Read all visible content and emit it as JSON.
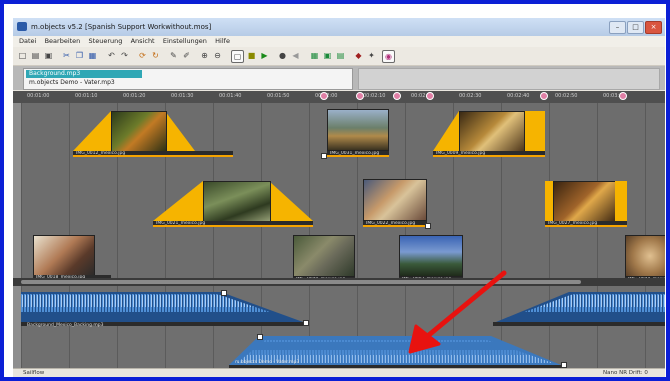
{
  "window": {
    "title": "m.objects v5.2  [Spanish Support Workwithout.mos]",
    "controls": [
      "–",
      "□",
      "×"
    ]
  },
  "menu": [
    "Datei",
    "Bearbeiten",
    "Steuerung",
    "Ansicht",
    "Einstellungen",
    "Hilfe"
  ],
  "toolbar": {
    "icons": [
      "new-icon",
      "open-icon",
      "save-icon",
      "cut-icon",
      "copy-icon",
      "paste-icon",
      "undo-icon",
      "redo-icon",
      "rotate-icon",
      "refresh-icon",
      "pen-icon",
      "pencil-icon",
      "zoom-in-icon",
      "zoom-out-icon",
      "select-frame-icon",
      "stop-icon",
      "play-icon",
      "record-icon",
      "prev-icon",
      "grid-icon",
      "image-icon",
      "clip-icon",
      "speaker-icon",
      "magic-icon",
      "circle-icon"
    ]
  },
  "objects": {
    "items": [
      "Background.mp3",
      "m.objects Demo - Vater.mp3"
    ]
  },
  "ruler": {
    "ticks": [
      "00:01:00",
      "00:01:10",
      "00:01:20",
      "00:01:30",
      "00:01:40",
      "00:01:50",
      "00:02:00",
      "00:02:10",
      "00:02:20",
      "00:02:30",
      "00:02:40",
      "00:02:50",
      "00:03:00"
    ]
  },
  "clips": {
    "video": [
      "IMG_0012_mexico.jpg",
      "IMG_0021_mexico.jpg",
      "IMG_0018_mexico.jpg",
      "IMG_0031_mexico.jpg",
      "IMG_0022_mexico.jpg",
      "IMG_0040_mexico.jpg",
      "IMG_0007_mexico.jpg",
      "IMG_0009_mexico.jpg",
      "IMG_0027_mexico.jpg",
      "IMG_0044_mexico.jpg"
    ],
    "audio": [
      "Background_Mexico_Backing.mp3",
      "m.objects Demo - Vater.mp3"
    ]
  },
  "status": {
    "left": "Sailflow",
    "right": "Nano NR  Drift: 0"
  },
  "colors": {
    "frame": "#0b1fd6",
    "arrow": "#e8120f",
    "clip_ramp": "#f6b400",
    "audio_wave": "#2f6fb4"
  }
}
